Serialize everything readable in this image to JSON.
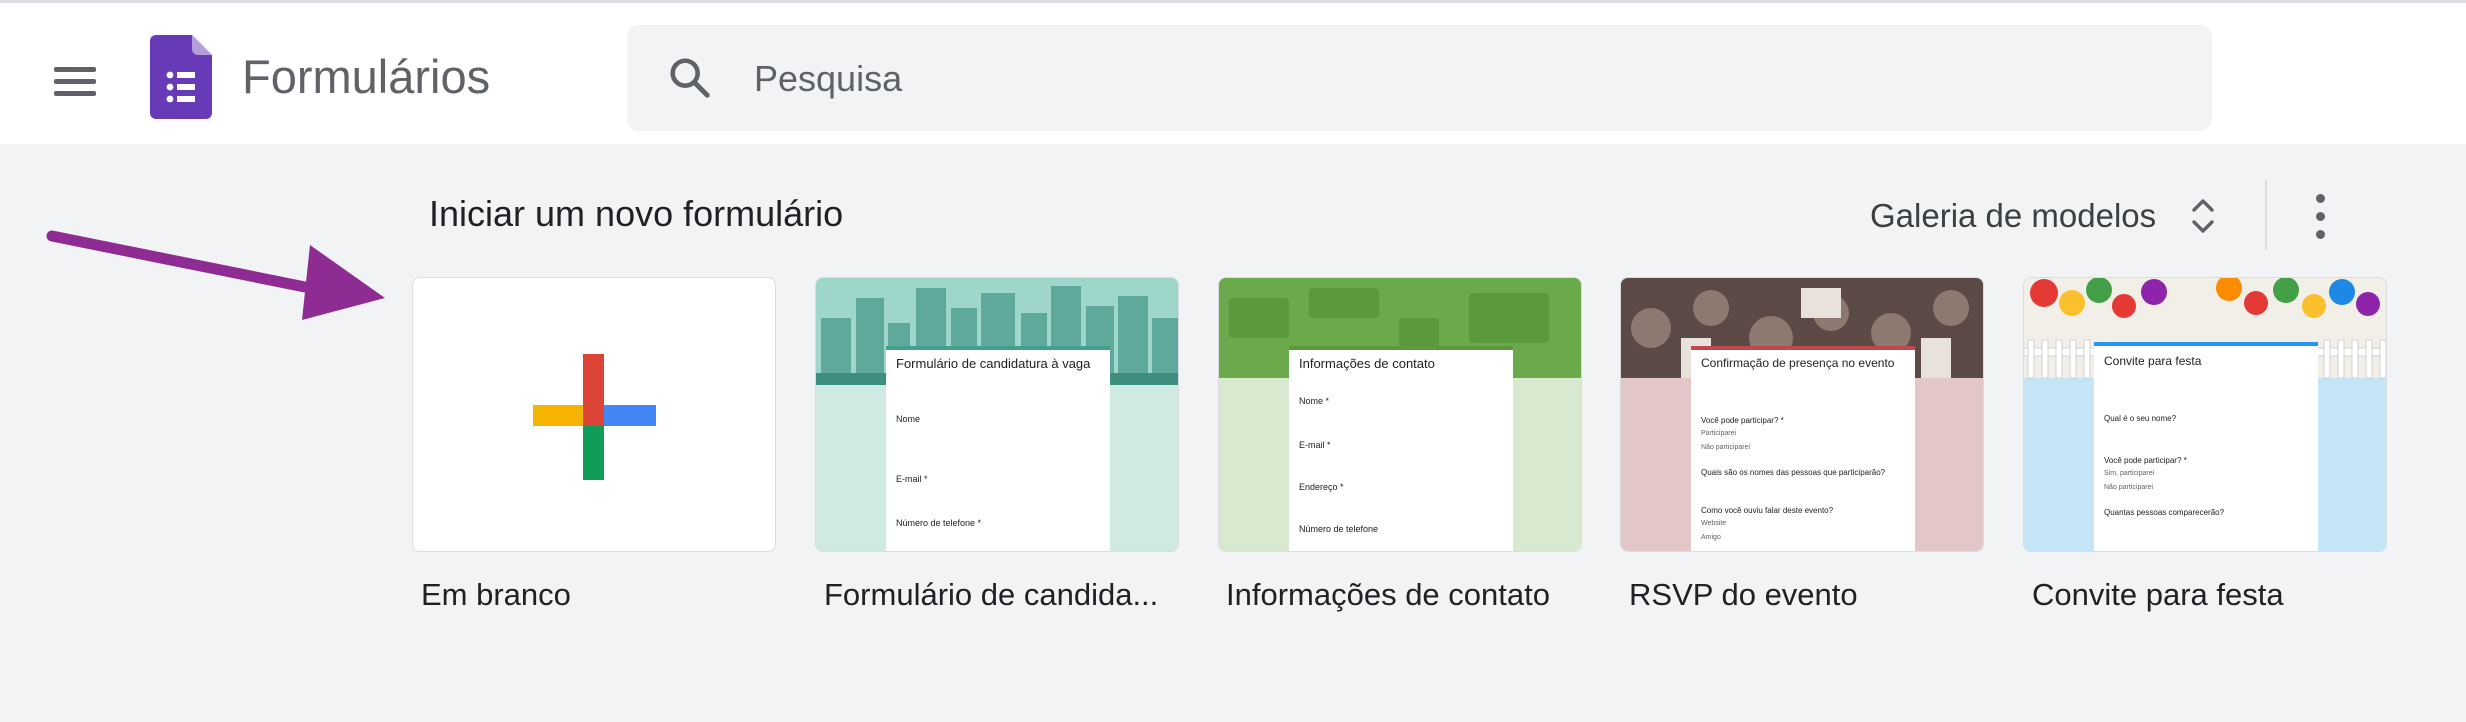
{
  "header": {
    "app_title": "Formulários",
    "search": {
      "placeholder": "Pesquisa",
      "value": ""
    }
  },
  "templates_section": {
    "title": "Iniciar um novo formulário",
    "gallery_label": "Galeria de modelos",
    "cards": [
      {
        "label": "Em branco"
      },
      {
        "label": "Formulário de candida...",
        "preview_title": "Formulário de candidatura à vaga",
        "fields": [
          "Nome",
          "E-mail *",
          "Número de telefone *"
        ]
      },
      {
        "label": "Informações de contato",
        "preview_title": "Informações de contato",
        "fields": [
          "Nome *",
          "E-mail *",
          "Endereço *",
          "Número de telefone"
        ]
      },
      {
        "label": "RSVP do evento",
        "preview_title": "Confirmação de presença no evento",
        "fields": [
          "Você pode participar? *",
          "Participarei",
          "Não participarei",
          "Quais são os nomes das pessoas que participarão?",
          "Como você ouviu falar deste evento?",
          "Website",
          "Amigo"
        ]
      },
      {
        "label": "Convite para festa",
        "preview_title": "Convite para festa",
        "fields": [
          "Qual é o seu nome?",
          "Você pode participar? *",
          "Sim, participarei",
          "Não participarei",
          "Quantas pessoas comparecerão?"
        ]
      }
    ]
  },
  "annotation": {
    "arrow_color": "#8e2c93"
  },
  "colors": {
    "forms_purple": "#673ab7",
    "plus_red": "#db4437",
    "plus_blue": "#4285f4",
    "plus_yellow": "#f4b400",
    "plus_green": "#0f9d58"
  }
}
